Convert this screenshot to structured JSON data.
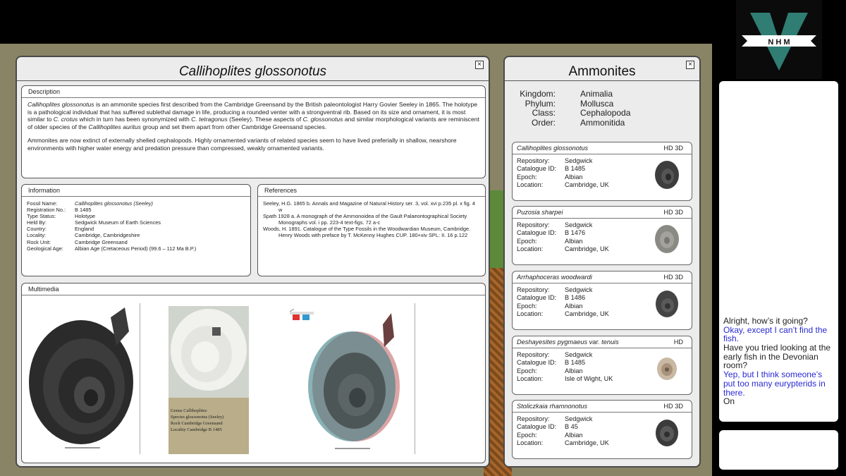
{
  "species": {
    "title": "Callihoplites glossonotus",
    "close_glyph": "×"
  },
  "description": {
    "heading": "Description",
    "p1_a": "Callihoplites glossonotus",
    "p1_b": " is an ammonite species first described from the Cambridge Greensand by the British paleontologist Harry Govier Seeley in 1865. The holotype is a pathological individual that has suffered sublethal damage in life, producing a rounded venter with a strongventral rib. Based on its size and ornament, it is most similar to ",
    "p1_c": "C. crotus",
    "p1_d": " which in turn has been synonymized with ",
    "p1_e": "C. tetragonus",
    "p1_f": " (Seeley). These aspects of ",
    "p1_g": "C. glossonotus",
    "p1_h": " and similar morphological variants are reminiscent of older species of the ",
    "p1_i": "Callihoplites auritus",
    "p1_j": " group and set them apart from other Cambridge Greensand species.",
    "p2": "Ammonites are now extinct of externally shelled cephalopods. Highly ornamented variants of related species seem to have lived preferially in shallow, nearshore environments with higher water energy and predation pressure than compressed, weakly ornamented variants."
  },
  "information": {
    "heading": "Information",
    "rows": [
      {
        "k": "Fossil Name:",
        "v": "Callihoplites glossonotus  (Seeley)"
      },
      {
        "k": "Registration No.:",
        "v": "B 1485"
      },
      {
        "k": "Type Status:",
        "v": "Holotype"
      },
      {
        "k": "Held By:",
        "v": "Sedgwick Museum of Earth Sciences"
      },
      {
        "k": "Country:",
        "v": "England"
      },
      {
        "k": "Locality:",
        "v": "Cambridge, Cambridgeshire"
      },
      {
        "k": "Rock Unit:",
        "v": "Cambridge Greensand"
      },
      {
        "k": "Geological Age:",
        "v": "Albian Age (Cretaceous Period) (99.6 – 112 Ma B.P.)"
      }
    ]
  },
  "references": {
    "heading": "References",
    "items": [
      "Seeley, H.G. 1865 b. Annals and Magazine of Natural History ser. 3, vol. xvi p.235 pl. x fig. 4 w",
      "Spath 1928 a. A monograph of the Ammonoidea of the Gault Palaeontographical Society Monographs vol. i pp. 223-4 text-figs. 72 a-c",
      "Woods, H. 1891. Catalogue of the Type Fossils in the Woodwardian Museum, Cambridge. Henry Woods with preface by T. McKenny Hughes CUP. 180+xiv SPL: II. 16 p.122"
    ]
  },
  "multimedia": {
    "heading": "Multimedia",
    "label_line1": "Genus Callihoplites",
    "label_line2": "Species glossonotus (Seeley)",
    "label_line3": "Rock   Cambridge Greensand",
    "label_line4": "Locality   Cambridge",
    "label_number": "B 1485"
  },
  "ammonites": {
    "title": "Ammonites",
    "taxonomy": [
      {
        "k": "Kingdom:",
        "v": "Animalia"
      },
      {
        "k": "Phylum:",
        "v": "Mollusca"
      },
      {
        "k": "Class:",
        "v": "Cephalopoda"
      },
      {
        "k": "Order:",
        "v": "Ammonitida"
      }
    ],
    "labels": {
      "repo": "Repository:",
      "cat": "Catalogue ID:",
      "epoch": "Epoch:",
      "loc": "Location:"
    },
    "cards": [
      {
        "name": "Callihoplites glossonotus",
        "tag": "HD 3D",
        "repo": "Sedgwick",
        "cat": "B 1485",
        "epoch": "Albian",
        "loc": "Cambridge, UK"
      },
      {
        "name": "Puzosia sharpei",
        "tag": "HD 3D",
        "repo": "Sedgwick",
        "cat": "B 1476",
        "epoch": "Albian",
        "loc": "Cambridge, UK"
      },
      {
        "name": "Arrhaphoceras woodwardi",
        "tag": "HD 3D",
        "repo": "Sedgwick",
        "cat": "B 1486",
        "epoch": "Albian",
        "loc": "Cambridge, UK"
      },
      {
        "name": "Deshayesites pygmaeus var. tenuis",
        "tag": "HD",
        "repo": "Sedgwick",
        "cat": "B 1485",
        "epoch": "Albian",
        "loc": "Isle of Wight, UK"
      },
      {
        "name": "Stoliczkaia rhamnonotus",
        "tag": "HD 3D",
        "repo": "Sedgwick",
        "cat": "B 45",
        "epoch": "Albian",
        "loc": "Cambridge, UK"
      }
    ]
  },
  "logo": {
    "text": "N H M"
  },
  "chat": {
    "lines": [
      {
        "text": "Alright, how’s it going?",
        "me": false
      },
      {
        "text": "Okay, except I can’t find the fish.",
        "me": true
      },
      {
        "text": "Have you tried looking at the early fish in the Devonian room?",
        "me": false
      },
      {
        "text": "Yep, but I think someone’s put too many eurypterids in there.",
        "me": true
      },
      {
        "text": "On",
        "me": false
      }
    ]
  }
}
